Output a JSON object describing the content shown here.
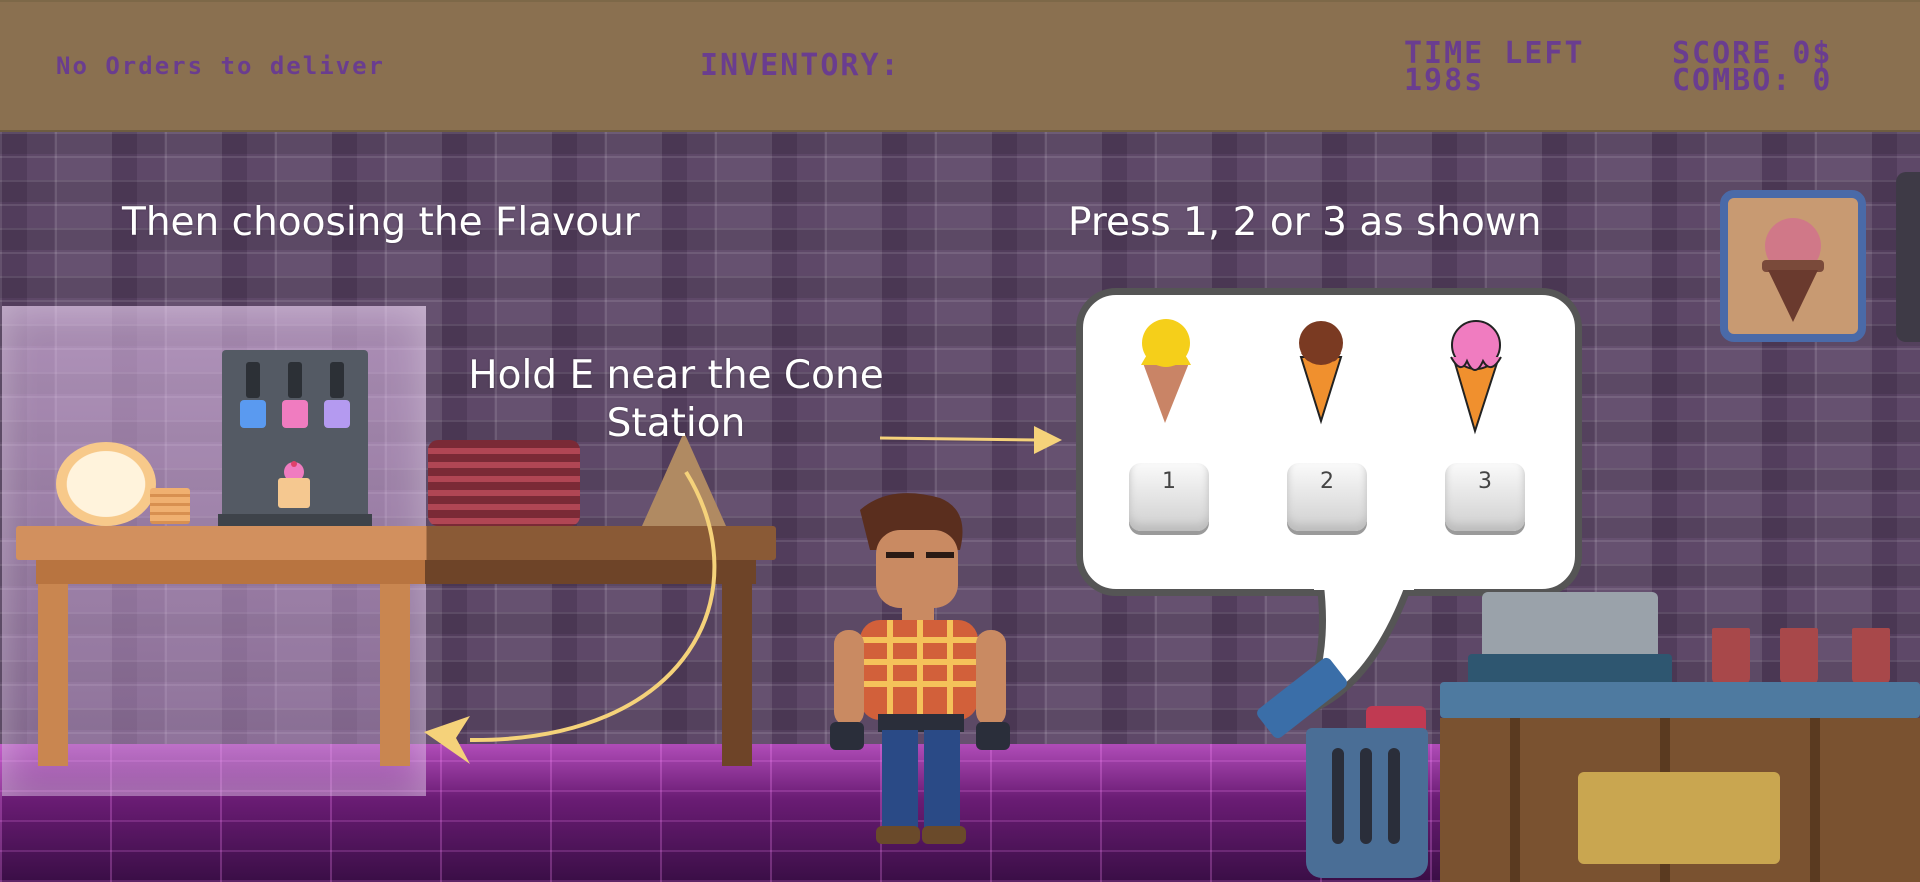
{
  "hud": {
    "orders_text": "No Orders to deliver",
    "inventory_label": "INVENTORY:",
    "time_label": "TIME LEFT",
    "time_value": "198s",
    "score_text": "SCORE 0$",
    "combo_text": "COMBO: 0"
  },
  "tutorial": {
    "flavour_text": "Then choosing the Flavour",
    "press_text": "Press 1, 2 or 3 as shown",
    "hold_text": "Hold E near the Cone Station"
  },
  "flavours": [
    {
      "name": "vanilla",
      "color": "#f5cf1a",
      "key": "1"
    },
    {
      "name": "chocolate",
      "color": "#7a3a22",
      "key": "2"
    },
    {
      "name": "strawberry",
      "color": "#f07cc0",
      "key": "3"
    }
  ],
  "colors": {
    "hud_bg": "#8a7050",
    "hud_text": "#6a3d8f",
    "arrow": "#f5d27a"
  }
}
